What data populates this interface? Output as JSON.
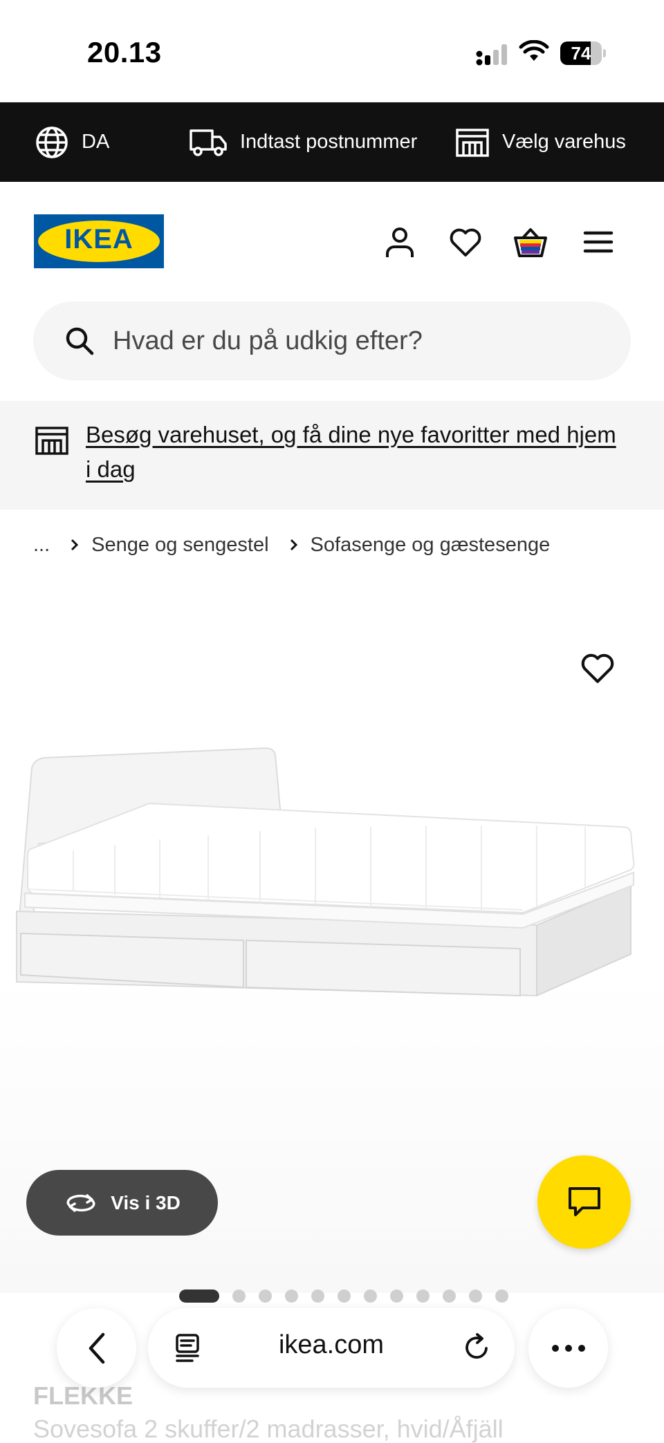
{
  "status_bar": {
    "time": "20.13",
    "battery": "74",
    "battery_fraction": 0.74
  },
  "topbar": {
    "language": "DA",
    "postcode": "Indtast postnummer",
    "store": "Vælg varehus"
  },
  "header": {
    "logo_text": "IKEA"
  },
  "search": {
    "placeholder": "Hvad er du på udkig efter?"
  },
  "banner": {
    "text": "Besøg varehuset, og få dine nye favoritter med hjem i dag"
  },
  "breadcrumb": {
    "ellipsis": "...",
    "items": [
      "Senge og sengestel",
      "Sofasenge og gæstesenge"
    ]
  },
  "gallery": {
    "view_3d_label": "Vis i 3D",
    "image_count": 12,
    "active_index": 0
  },
  "product": {
    "name": "FLEKKE",
    "description": "Sovesofa 2 skuffer/2 madrasser, hvid/Åfjäll"
  },
  "browser": {
    "url": "ikea.com"
  },
  "colors": {
    "ikea_blue": "#0058a3",
    "ikea_yellow": "#ffdb00",
    "topbar_bg": "#111111"
  }
}
